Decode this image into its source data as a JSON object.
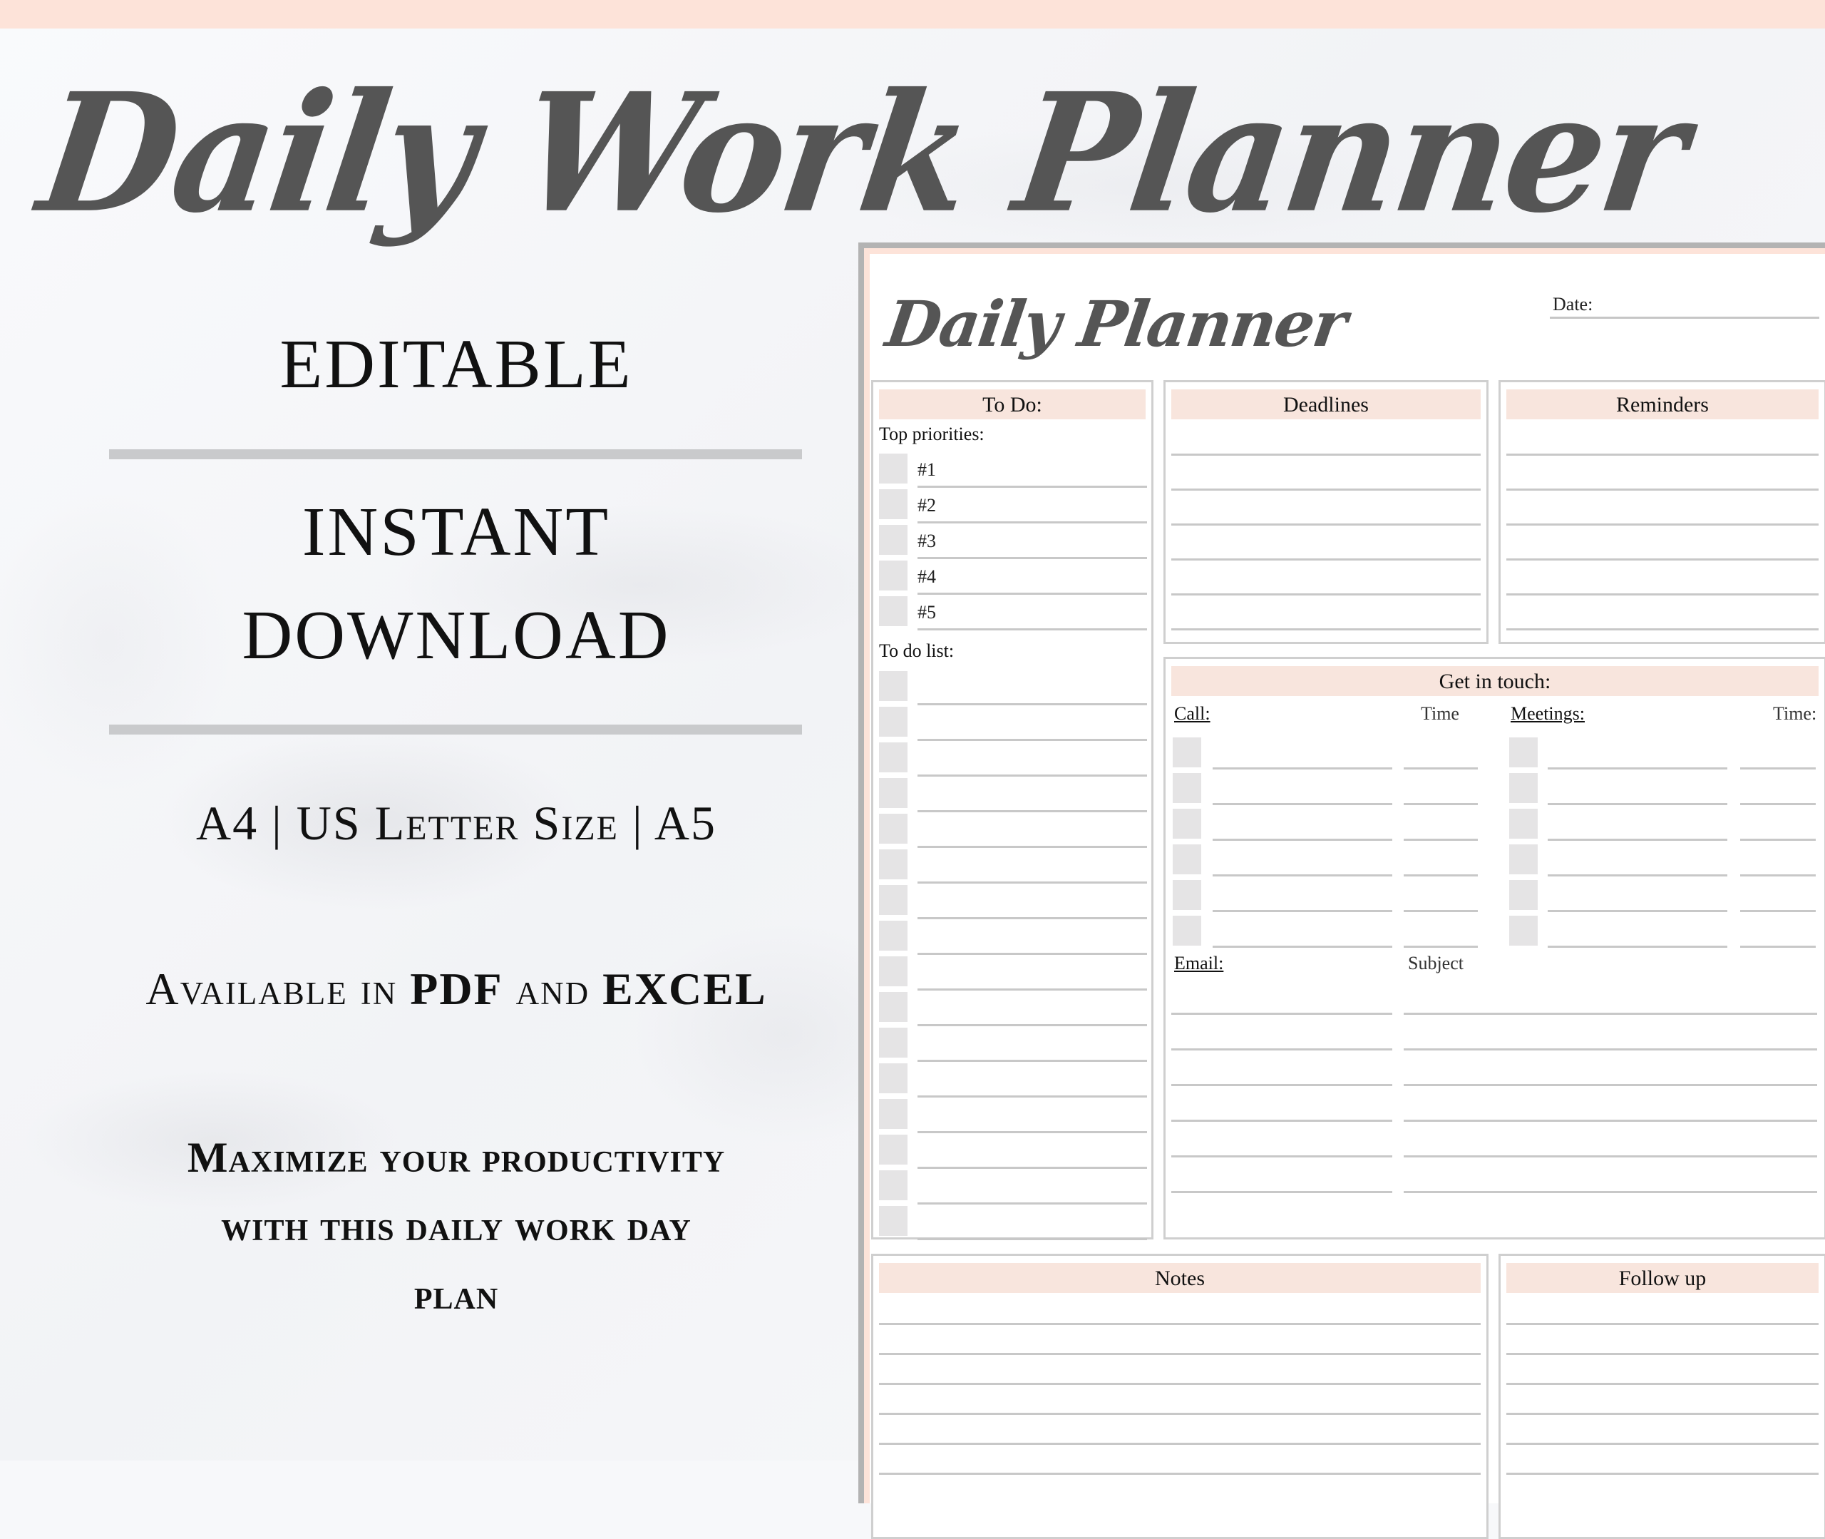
{
  "hero": {
    "title": "Daily Work Planner"
  },
  "features": {
    "editable": "EDITABLE",
    "instant": "INSTANT",
    "download": "DOWNLOAD",
    "sizes": "A4 | US Letter Size | A5",
    "available_prefix": "Available in ",
    "available_pdf": "PDF",
    "available_mid": " and ",
    "available_excel": "EXCEL",
    "maximize_line1": "Maximize your productivity",
    "maximize_line2": "with this daily work day",
    "maximize_line3": "plan"
  },
  "planner": {
    "title": "Daily Planner",
    "date_label": "Date:",
    "todo": {
      "header": "To Do:",
      "top_priorities_label": "Top priorities:",
      "priorities": [
        "#1",
        "#2",
        "#3",
        "#4",
        "#5"
      ],
      "todo_list_label": "To do list:",
      "todo_list_rows": 16
    },
    "deadlines": {
      "header": "Deadlines",
      "rows": 6
    },
    "reminders": {
      "header": "Reminders",
      "rows": 6
    },
    "get_in_touch": {
      "header": "Get in touch:",
      "call_label": "Call:",
      "call_time_label": "Time",
      "meetings_label": "Meetings:",
      "meetings_time_label": "Time:",
      "call_rows": 6,
      "meeting_rows": 6,
      "email_label": "Email:",
      "subject_label": "Subject",
      "email_rows": 6
    },
    "notes": {
      "header": "Notes"
    },
    "follow_up": {
      "header": "Follow up"
    }
  },
  "colors": {
    "accent_pink": "#fde3d9",
    "header_pink": "#f8e5dd",
    "title_gray": "#555555",
    "rule_gray": "#c8c8c8",
    "checkbox_gray": "#e5e4e5"
  }
}
